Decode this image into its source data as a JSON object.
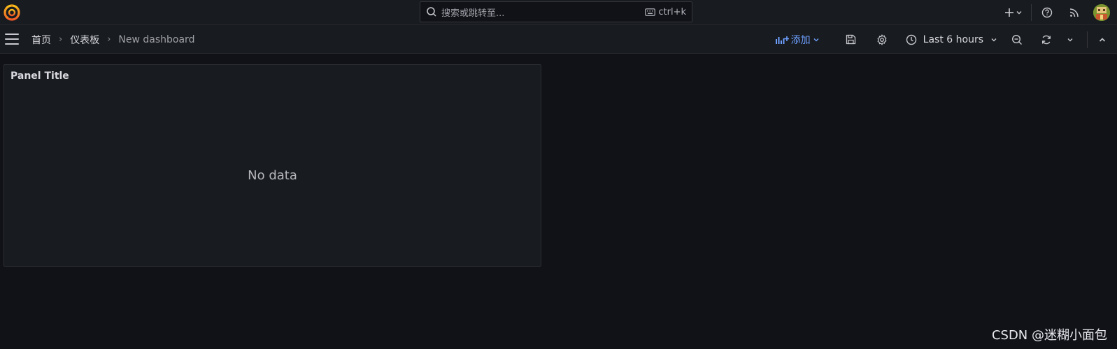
{
  "topbar": {
    "search_placeholder": "搜索或跳转至...",
    "search_shortcut": "ctrl+k",
    "icons": [
      "grafana-logo-icon",
      "search-icon",
      "keyboard-icon",
      "plus-icon",
      "chevron-down-icon",
      "help-icon",
      "news-rss-icon",
      "user-avatar"
    ]
  },
  "breadcrumb": {
    "items": [
      "首页",
      "仪表板",
      "New dashboard"
    ],
    "separator": "›"
  },
  "toolbar": {
    "add_label": "添加",
    "time_range_label": "Last 6 hours",
    "icons": [
      "add-panel-icon",
      "save-icon",
      "settings-gear-icon",
      "clock-icon",
      "zoom-out-icon",
      "refresh-icon",
      "chevron-down-icon",
      "chevron-up-icon"
    ]
  },
  "panel": {
    "title": "Panel Title",
    "empty_text": "No data"
  },
  "watermark": "CSDN @迷糊小面包",
  "colors": {
    "background": "#111217",
    "bar": "#181b1f",
    "accent_blue": "#6e9fff",
    "logo_orange": "#f28f1c"
  }
}
